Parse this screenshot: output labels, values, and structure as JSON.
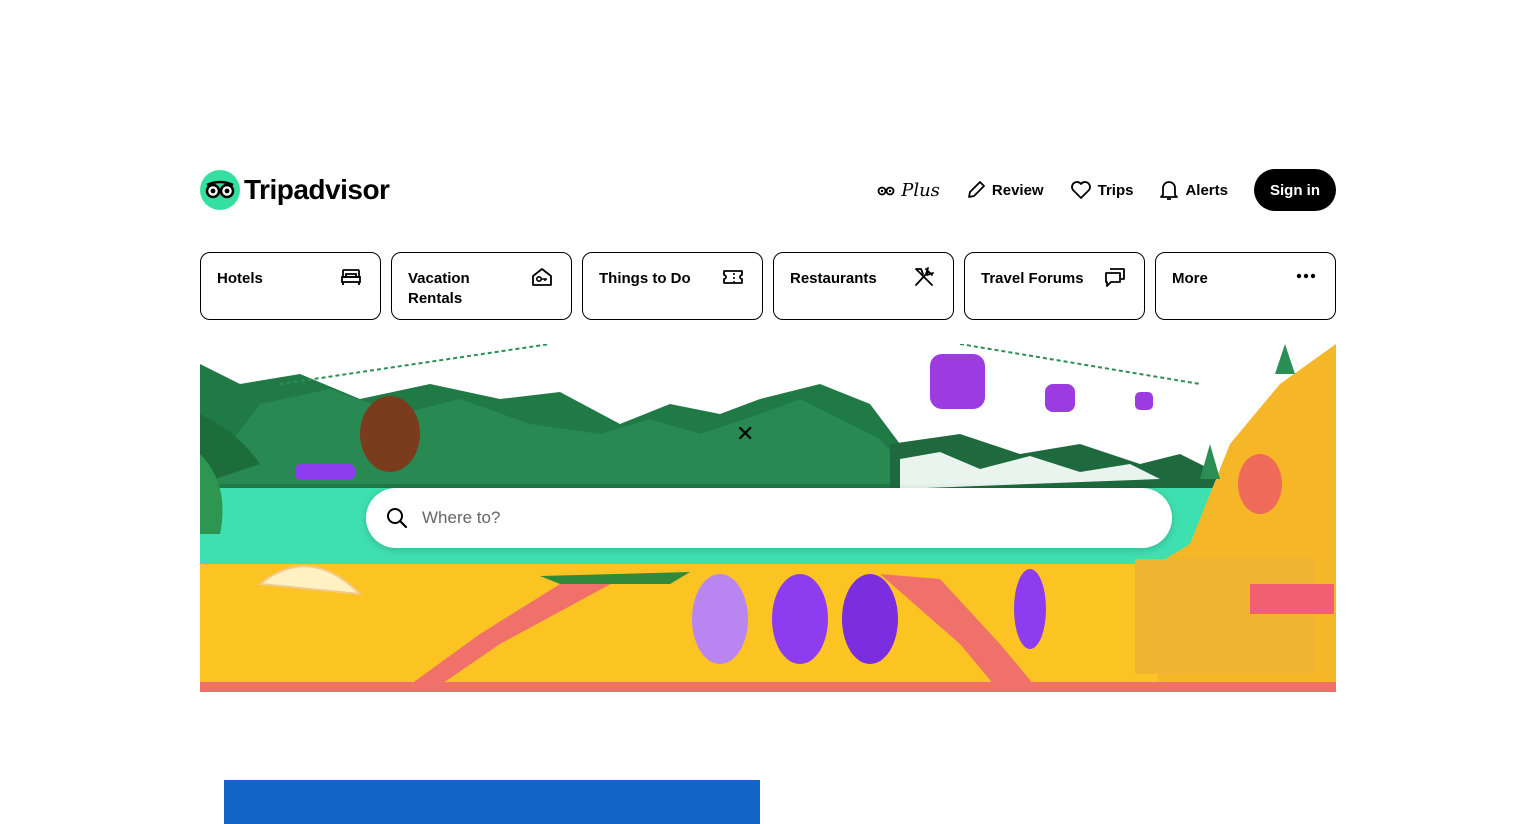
{
  "brand": {
    "name": "Tripadvisor",
    "logo_icon": "owl-eyes-icon",
    "accent": "#34e0a1"
  },
  "nav": {
    "plus_label": "Plus",
    "review_label": "Review",
    "trips_label": "Trips",
    "alerts_label": "Alerts",
    "signin_label": "Sign in"
  },
  "categories": [
    {
      "label": "Hotels",
      "icon": "bed-icon"
    },
    {
      "label": "Vacation Rentals",
      "icon": "house-key-icon"
    },
    {
      "label": "Things to Do",
      "icon": "ticket-icon"
    },
    {
      "label": "Restaurants",
      "icon": "fork-knife-icon"
    },
    {
      "label": "Travel Forums",
      "icon": "speech-bubbles-icon"
    },
    {
      "label": "More",
      "icon": "more-dots-icon"
    }
  ],
  "search": {
    "placeholder": "Where to?"
  },
  "colors": {
    "mountain": "#1f7a45",
    "sea": "#3fe0b0",
    "sand": "#fbc423",
    "path": "#f0706a",
    "cablecar": "#9b3be0",
    "ad": "#1366c7"
  }
}
